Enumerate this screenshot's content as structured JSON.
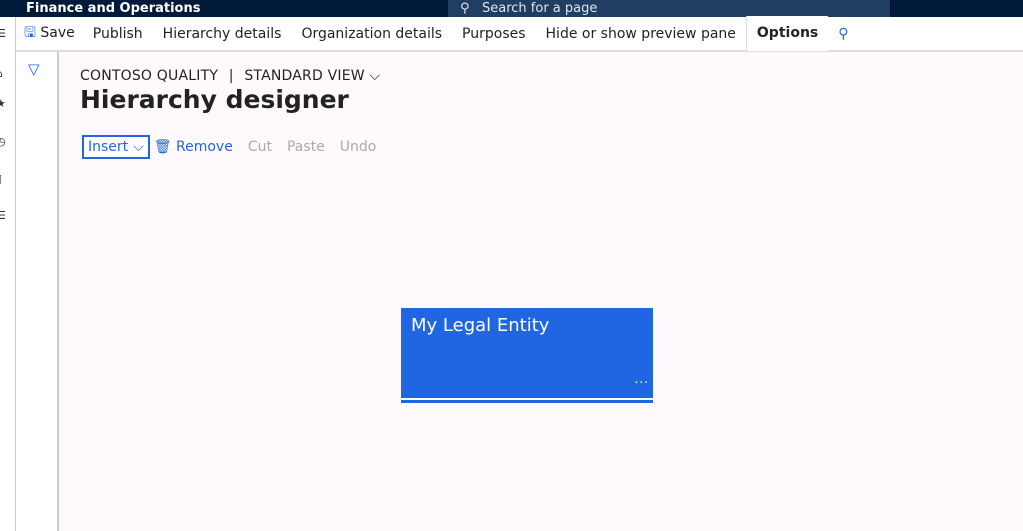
{
  "app": {
    "title": "Finance and Operations",
    "search_placeholder": "Search for a page"
  },
  "actionbar": {
    "save": "Save",
    "items": [
      "Publish",
      "Hierarchy details",
      "Organization details",
      "Purposes",
      "Hide or show preview pane"
    ],
    "options": "Options"
  },
  "header": {
    "company": "CONTOSO QUALITY",
    "separator": "|",
    "view": "STANDARD VIEW",
    "title": "Hierarchy designer"
  },
  "toolbar": {
    "insert": "Insert",
    "remove": "Remove",
    "cut": "Cut",
    "paste": "Paste",
    "undo": "Undo"
  },
  "node": {
    "name": "My Legal Entity",
    "more": "..."
  },
  "colors": {
    "accent": "#2266e3",
    "topbar": "#021a3a",
    "node": "#2066e3"
  }
}
